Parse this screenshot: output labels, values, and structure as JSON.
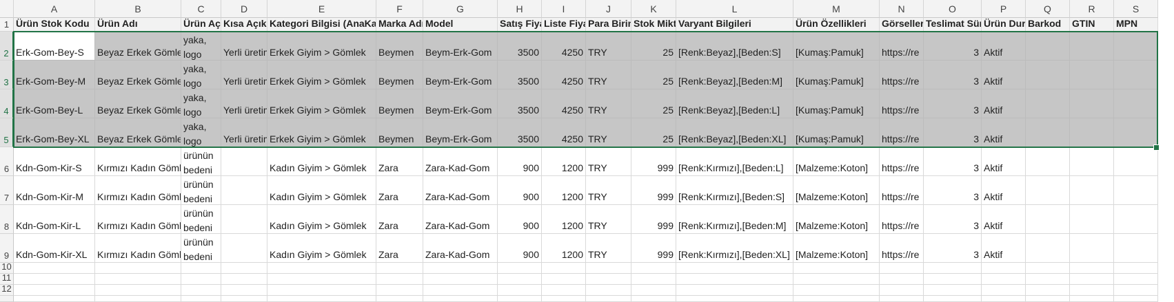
{
  "columns": [
    "A",
    "B",
    "C",
    "D",
    "E",
    "F",
    "G",
    "H",
    "I",
    "J",
    "K",
    "L",
    "M",
    "N",
    "O",
    "P",
    "Q",
    "R",
    "S"
  ],
  "header_row": [
    "Ürün Stok Kodu",
    "Ürün Adı",
    "Ürün Açıklama",
    "Kısa Açıklama",
    "Kategori Bilgisi (AnaKategori)",
    "Marka Adı",
    "Model",
    "Satış Fiyatı",
    "Liste Fiyatı",
    "Para Birimi",
    "Stok Miktarı",
    "Varyant Bilgileri",
    "Ürün Özellikleri",
    "Görseller",
    "Teslimat Süresi",
    "Ürün Durumu",
    "Barkod",
    "GTIN",
    "MPN"
  ],
  "rows": [
    [
      "Erk-Gom-Bey-S",
      "Beyaz Erkek Gömlek",
      "yaka, logo",
      "Yerli üretim",
      "Erkek Giyim > Gömlek",
      "Beymen",
      "Beym-Erk-Gom",
      "3500",
      "4250",
      "TRY",
      "25",
      "[Renk:Beyaz],[Beden:S]",
      "[Kumaş:Pamuk]",
      "https://re",
      "3",
      "Aktif",
      "",
      "",
      ""
    ],
    [
      "Erk-Gom-Bey-M",
      "Beyaz Erkek Gömlek",
      "yaka, logo",
      "Yerli üretim",
      "Erkek Giyim > Gömlek",
      "Beymen",
      "Beym-Erk-Gom",
      "3500",
      "4250",
      "TRY",
      "25",
      "[Renk:Beyaz],[Beden:M]",
      "[Kumaş:Pamuk]",
      "https://re",
      "3",
      "Aktif",
      "",
      "",
      ""
    ],
    [
      "Erk-Gom-Bey-L",
      "Beyaz Erkek Gömlek",
      "yaka, logo",
      "Yerli üretim",
      "Erkek Giyim > Gömlek",
      "Beymen",
      "Beym-Erk-Gom",
      "3500",
      "4250",
      "TRY",
      "25",
      "[Renk:Beyaz],[Beden:L]",
      "[Kumaş:Pamuk]",
      "https://re",
      "3",
      "Aktif",
      "",
      "",
      ""
    ],
    [
      "Erk-Gom-Bey-XL",
      "Beyaz Erkek Gömlek",
      "yaka, logo",
      "Yerli üretim",
      "Erkek Giyim > Gömlek",
      "Beymen",
      "Beym-Erk-Gom",
      "3500",
      "4250",
      "TRY",
      "25",
      "[Renk:Beyaz],[Beden:XL]",
      "[Kumaş:Pamuk]",
      "https://re",
      "3",
      "Aktif",
      "",
      "",
      ""
    ],
    [
      "Kdn-Gom-Kir-S",
      "Kırmızı Kadın Gömlek",
      "ürünün bedeni",
      "",
      "Kadın Giyim > Gömlek",
      "Zara",
      "Zara-Kad-Gom",
      "900",
      "1200",
      "TRY",
      "999",
      "[Renk:Kırmızı],[Beden:L]",
      "[Malzeme:Koton]",
      "https://re",
      "3",
      "Aktif",
      "",
      "",
      ""
    ],
    [
      "Kdn-Gom-Kir-M",
      "Kırmızı Kadın Gömlek",
      "ürünün bedeni",
      "",
      "Kadın Giyim > Gömlek",
      "Zara",
      "Zara-Kad-Gom",
      "900",
      "1200",
      "TRY",
      "999",
      "[Renk:Kırmızı],[Beden:S]",
      "[Malzeme:Koton]",
      "https://re",
      "3",
      "Aktif",
      "",
      "",
      ""
    ],
    [
      "Kdn-Gom-Kir-L",
      "Kırmızı Kadın Gömlek",
      "ürünün bedeni",
      "",
      "Kadın Giyim > Gömlek",
      "Zara",
      "Zara-Kad-Gom",
      "900",
      "1200",
      "TRY",
      "999",
      "[Renk:Kırmızı],[Beden:M]",
      "[Malzeme:Koton]",
      "https://re",
      "3",
      "Aktif",
      "",
      "",
      ""
    ],
    [
      "Kdn-Gom-Kir-XL",
      "Kırmızı Kadın Gömlek",
      "ürünün bedeni",
      "",
      "Kadın Giyim > Gömlek",
      "Zara",
      "Zara-Kad-Gom",
      "900",
      "1200",
      "TRY",
      "999",
      "[Renk:Kırmızı],[Beden:XL]",
      "[Malzeme:Koton]",
      "https://re",
      "3",
      "Aktif",
      "",
      "",
      ""
    ],
    [
      "",
      "",
      "",
      "",
      "",
      "",
      "",
      "",
      "",
      "",
      "",
      "",
      "",
      "",
      "",
      "",
      "",
      "",
      ""
    ],
    [
      "",
      "",
      "",
      "",
      "",
      "",
      "",
      "",
      "",
      "",
      "",
      "",
      "",
      "",
      "",
      "",
      "",
      "",
      ""
    ],
    [
      "",
      "",
      "",
      "",
      "",
      "",
      "",
      "",
      "",
      "",
      "",
      "",
      "",
      "",
      "",
      "",
      "",
      "",
      ""
    ]
  ],
  "row_numbers": [
    "1",
    "2",
    "3",
    "4",
    "5",
    "6",
    "7",
    "8",
    "9",
    "10",
    "11",
    "12"
  ],
  "selection": {
    "first_row": 2,
    "last_row": 5,
    "active_row": 2,
    "active_col": "A"
  },
  "colors": {
    "selection_border": "#217346",
    "selection_fill": "#c6c6c6",
    "header_fill": "#f2f2f2"
  }
}
